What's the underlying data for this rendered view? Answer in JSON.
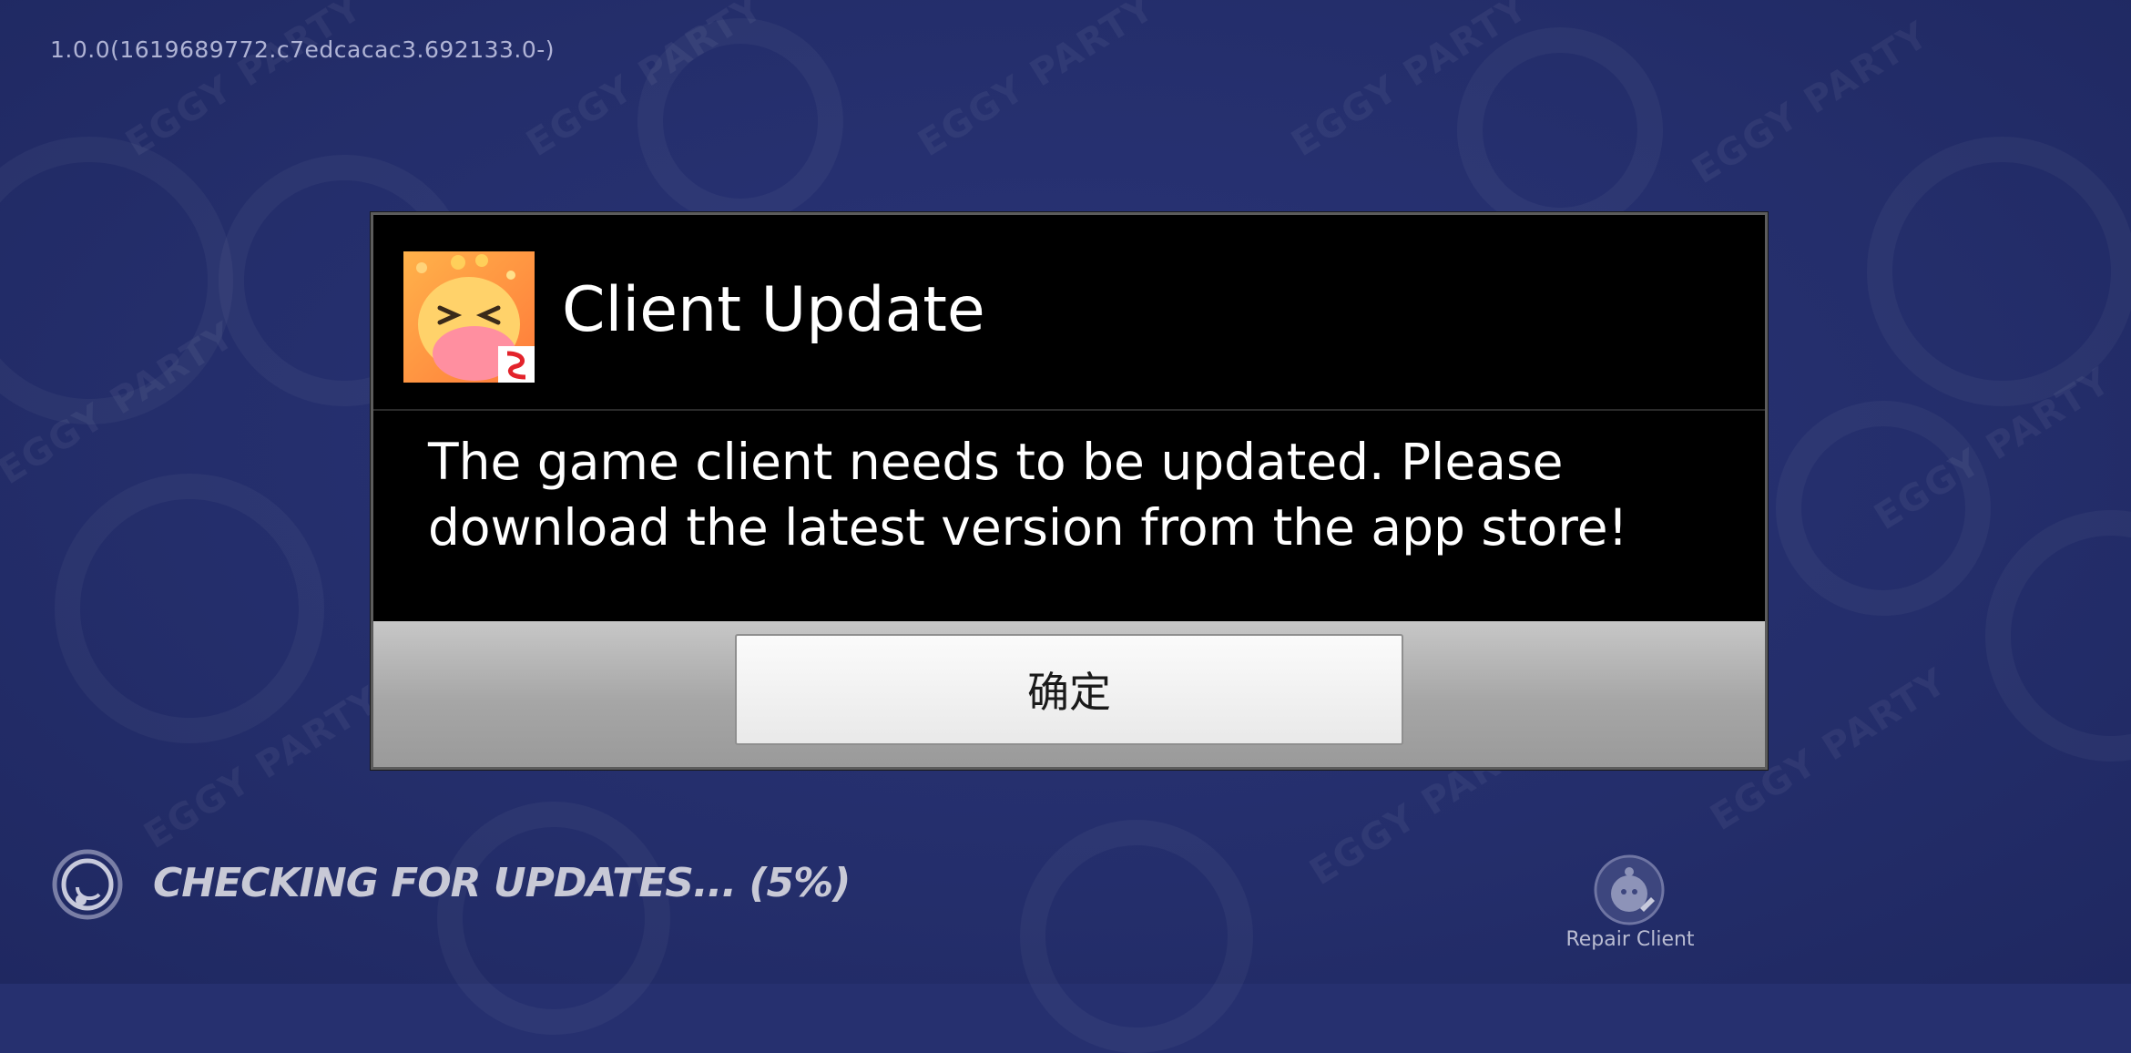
{
  "app": {
    "version": "1.0.0(1619689772.c7edcacac3.692133.0-)",
    "watermark_text": "EGGY PARTY"
  },
  "dialog": {
    "title": "Client Update",
    "message": "The game client needs to be updated. Please download the latest version from the app store!",
    "ok_label": "确定",
    "icon": "eggy-party-app-icon"
  },
  "status": {
    "text": "CHECKING FOR UPDATES... (5%)",
    "progress_percent": 5
  },
  "repair": {
    "label": "Repair Client",
    "icon": "repair-client-icon"
  },
  "colors": {
    "background": "#26306f",
    "dialog_bg": "#000000",
    "dialog_footer": "#b5b5b5",
    "button_bg": "#f2f2f2",
    "status_text": "#c8c9d6"
  }
}
